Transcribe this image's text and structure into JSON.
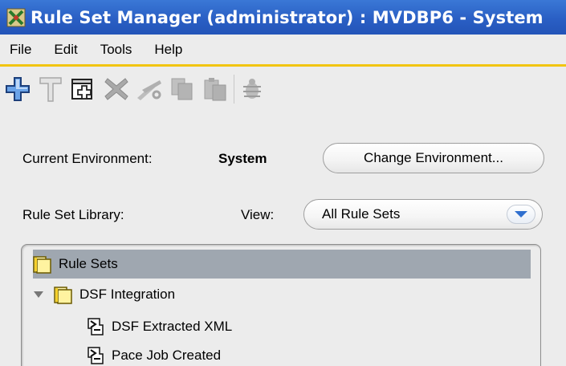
{
  "window": {
    "title": "Rule Set Manager (administrator) : MVDBP6 - System"
  },
  "menu": {
    "items": [
      "File",
      "Edit",
      "Tools",
      "Help"
    ]
  },
  "toolbar": {
    "icons": [
      "add-icon",
      "hammer-icon",
      "new-window-icon",
      "delete-icon",
      "cut-icon",
      "copy-icon",
      "paste-icon",
      "bug-icon"
    ]
  },
  "environment": {
    "label": "Current Environment:",
    "value": "System",
    "change_button": "Change Environment..."
  },
  "library": {
    "label": "Rule Set Library:",
    "view_label": "View:",
    "view_selected": "All Rule Sets"
  },
  "tree": {
    "root": "Rule Sets",
    "folder": "DSF Integration",
    "children": [
      "DSF Extracted XML",
      "Pace Job Created"
    ]
  },
  "colors": {
    "titlebar": "#2a5fc4",
    "accent_line": "#f2c511",
    "selection": "#9fa7b0"
  }
}
